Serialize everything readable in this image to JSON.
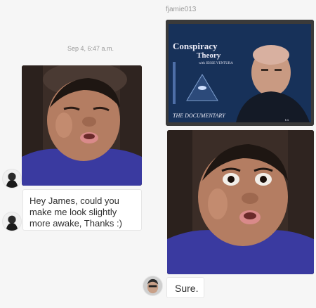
{
  "thread": {
    "other_user_name": "fjamie013",
    "timestamp": "Sep 4, 6:47 a.m."
  },
  "messages": {
    "sent_text": "Hey James, could you make me look slightly more awake, Thanks :)",
    "reply_text": "Sure."
  },
  "tv_image": {
    "title_line1": "Conspiracy",
    "title_line2": "Theory",
    "host": "with JESSE VENTURA",
    "subtitle": "THE DOCUMENTARY",
    "brand": "LG"
  },
  "colors": {
    "background": "#f6f6f6",
    "bubble": "#ffffff",
    "meta_text": "#9a9a9a",
    "shirt": "#3a3aa0",
    "tv_blue": "#1c3a6a"
  }
}
